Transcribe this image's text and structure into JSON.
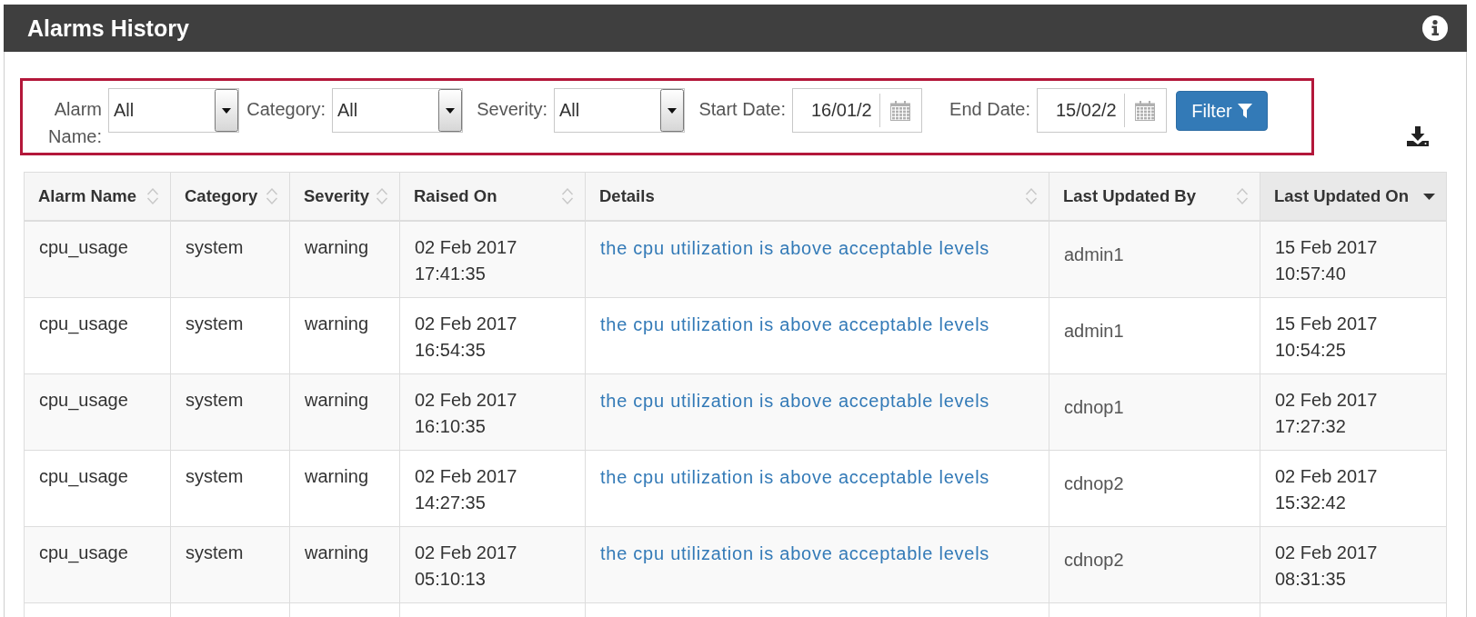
{
  "panel": {
    "title": "Alarms History"
  },
  "filters": {
    "fields": [
      {
        "kind": "select",
        "label": "Alarm Name:",
        "value": "All"
      },
      {
        "kind": "select",
        "label": "Category:",
        "value": "All"
      },
      {
        "kind": "select",
        "label": "Severity:",
        "value": "All"
      },
      {
        "kind": "date",
        "label": "Start Date:",
        "value": "16/01/2"
      },
      {
        "kind": "date",
        "label": "End Date:",
        "value": "15/02/2"
      }
    ],
    "button": "Filter"
  },
  "table": {
    "columns": [
      {
        "label": "Alarm Name",
        "kind": "text",
        "sorted": false
      },
      {
        "label": "Category",
        "kind": "text",
        "sorted": false
      },
      {
        "label": "Severity",
        "kind": "text",
        "sorted": false
      },
      {
        "label": "Raised On",
        "kind": "text",
        "sorted": false
      },
      {
        "label": "Details",
        "kind": "link",
        "sorted": false
      },
      {
        "label": "Last Updated By",
        "kind": "user",
        "sorted": false
      },
      {
        "label": "Last Updated On",
        "kind": "text",
        "sorted": true
      }
    ],
    "rows": [
      [
        "cpu_usage",
        "system",
        "warning",
        "02 Feb 2017 17:41:35",
        "the cpu utilization is above acceptable levels",
        "admin1",
        "15 Feb 2017 10:57:40"
      ],
      [
        "cpu_usage",
        "system",
        "warning",
        "02 Feb 2017 16:54:35",
        "the cpu utilization is above acceptable levels",
        "admin1",
        "15 Feb 2017 10:54:25"
      ],
      [
        "cpu_usage",
        "system",
        "warning",
        "02 Feb 2017 16:10:35",
        "the cpu utilization is above acceptable levels",
        "cdnop1",
        "02 Feb 2017 17:27:32"
      ],
      [
        "cpu_usage",
        "system",
        "warning",
        "02 Feb 2017 14:27:35",
        "the cpu utilization is above acceptable levels",
        "cdnop2",
        "02 Feb 2017 15:32:42"
      ],
      [
        "cpu_usage",
        "system",
        "warning",
        "02 Feb 2017 05:10:13",
        "the cpu utilization is above acceptable levels",
        "cdnop2",
        "02 Feb 2017 08:31:35"
      ]
    ]
  }
}
